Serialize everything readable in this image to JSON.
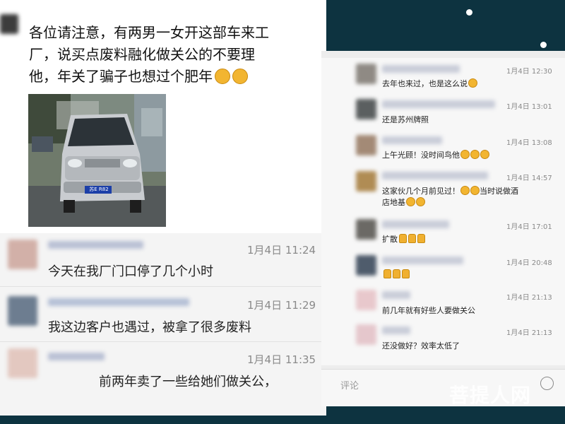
{
  "left_panel": {
    "post_text_lines": [
      "各位请注意，有两男一女开这部车来工",
      "厂，说买点废料融化做关公的不要理",
      "他，年关了骗子也想过个肥年"
    ],
    "post_emojis": [
      "grimace-emoji",
      "grimace-emoji"
    ],
    "photo": {
      "plate": "苏E R82",
      "description": "silver minivan parked outside factory"
    },
    "comments": [
      {
        "time": "1月4日 11:24",
        "text": "今天在我厂门口停了几个小时"
      },
      {
        "time": "1月4日 11:29",
        "text": "我这边客户也遇过，被拿了很多废料"
      },
      {
        "time": "1月4日 11:35",
        "text": "前两年卖了一些给她们做关公，"
      }
    ]
  },
  "right_panel": {
    "comments": [
      {
        "time": "1月4日 12:30",
        "text": "去年也来过，也是这么说"
      },
      {
        "time": "1月4日 13:01",
        "text": "还是苏州牌照"
      },
      {
        "time": "1月4日 13:08",
        "text": "上午光顾！没时间鸟他"
      },
      {
        "time": "1月4日 14:57",
        "text": "这家伙几个月前见过！",
        "text2": "当时说做酒",
        "text3": "店地基"
      },
      {
        "time": "1月4日 17:01",
        "text": "扩散"
      },
      {
        "time": "1月4日 20:48",
        "text": ""
      },
      {
        "time": "1月4日 21:13",
        "text": "前几年就有好些人要做关公"
      },
      {
        "time": "1月4日 21:13",
        "text": "还没做好？效率太低了"
      }
    ],
    "comment_placeholder": "评论"
  },
  "watermark": "菩提人网",
  "colors": {
    "background": "#0d3340",
    "panel": "#f7f7f7",
    "time_text": "#8a8a8a",
    "emoji": "#f2b531"
  }
}
